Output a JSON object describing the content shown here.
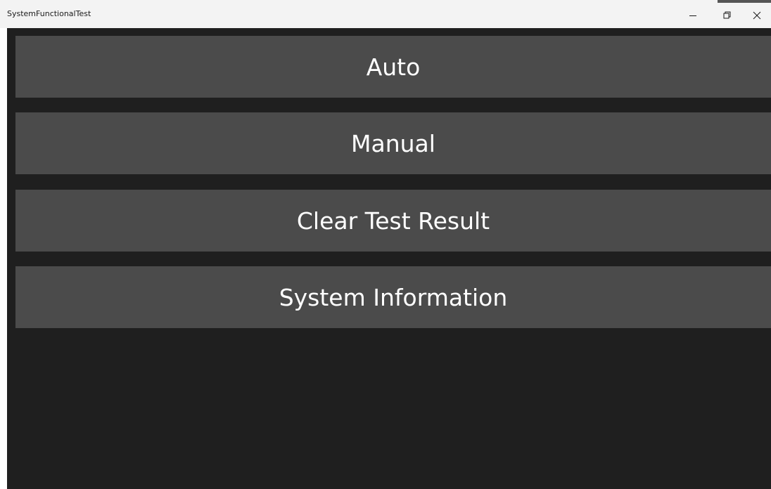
{
  "window": {
    "title": "SystemFunctionalTest",
    "controls": {
      "minimize_icon": "minimize-icon",
      "restore_icon": "restore-icon",
      "close_icon": "close-icon"
    }
  },
  "main": {
    "buttons": [
      {
        "label": "Auto"
      },
      {
        "label": "Manual"
      },
      {
        "label": "Clear Test Result"
      },
      {
        "label": "System Information"
      }
    ]
  },
  "colors": {
    "background": "#1f1f1f",
    "button": "#4b4b4b",
    "button_text": "#ffffff",
    "titlebar": "#f3f3f3"
  }
}
